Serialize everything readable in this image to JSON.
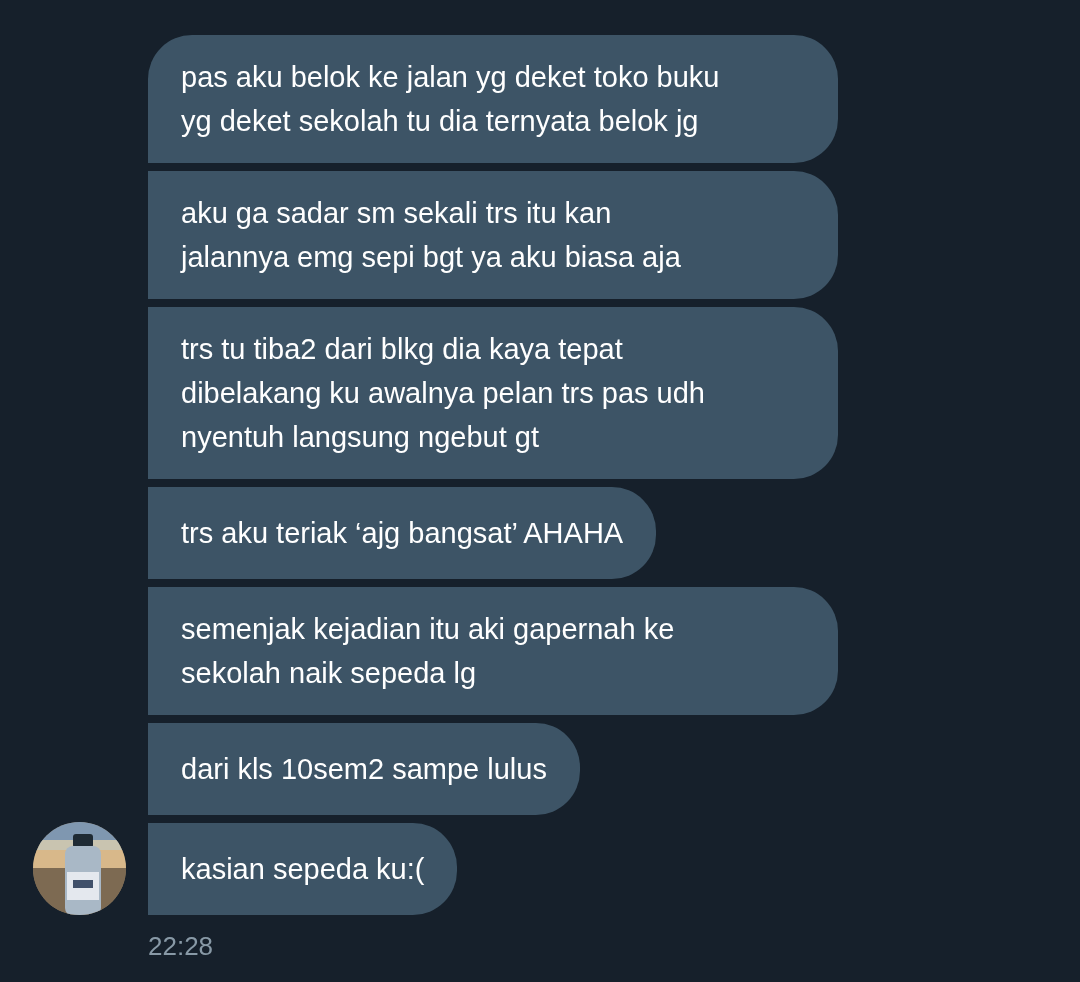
{
  "messages": [
    {
      "text": "pas aku belok ke jalan yg deket toko buku\nyg deket sekolah tu dia ternyata belok jg"
    },
    {
      "text": "aku ga sadar sm sekali trs itu kan\njalannya emg sepi bgt ya aku biasa aja"
    },
    {
      "text": "trs tu tiba2 dari blkg dia kaya tepat\ndibelakang ku awalnya pelan trs pas udh\nnyentuh langsung ngebut gt"
    },
    {
      "text": "trs aku teriak ‘ajg bangsat’ AHAHA"
    },
    {
      "text": "semenjak kejadian itu aki gapernah ke\nsekolah naik sepeda lg"
    },
    {
      "text": "dari kls 10sem2 sampe lulus"
    },
    {
      "text": "kasian sepeda ku:("
    }
  ],
  "timestamp": "22:28"
}
